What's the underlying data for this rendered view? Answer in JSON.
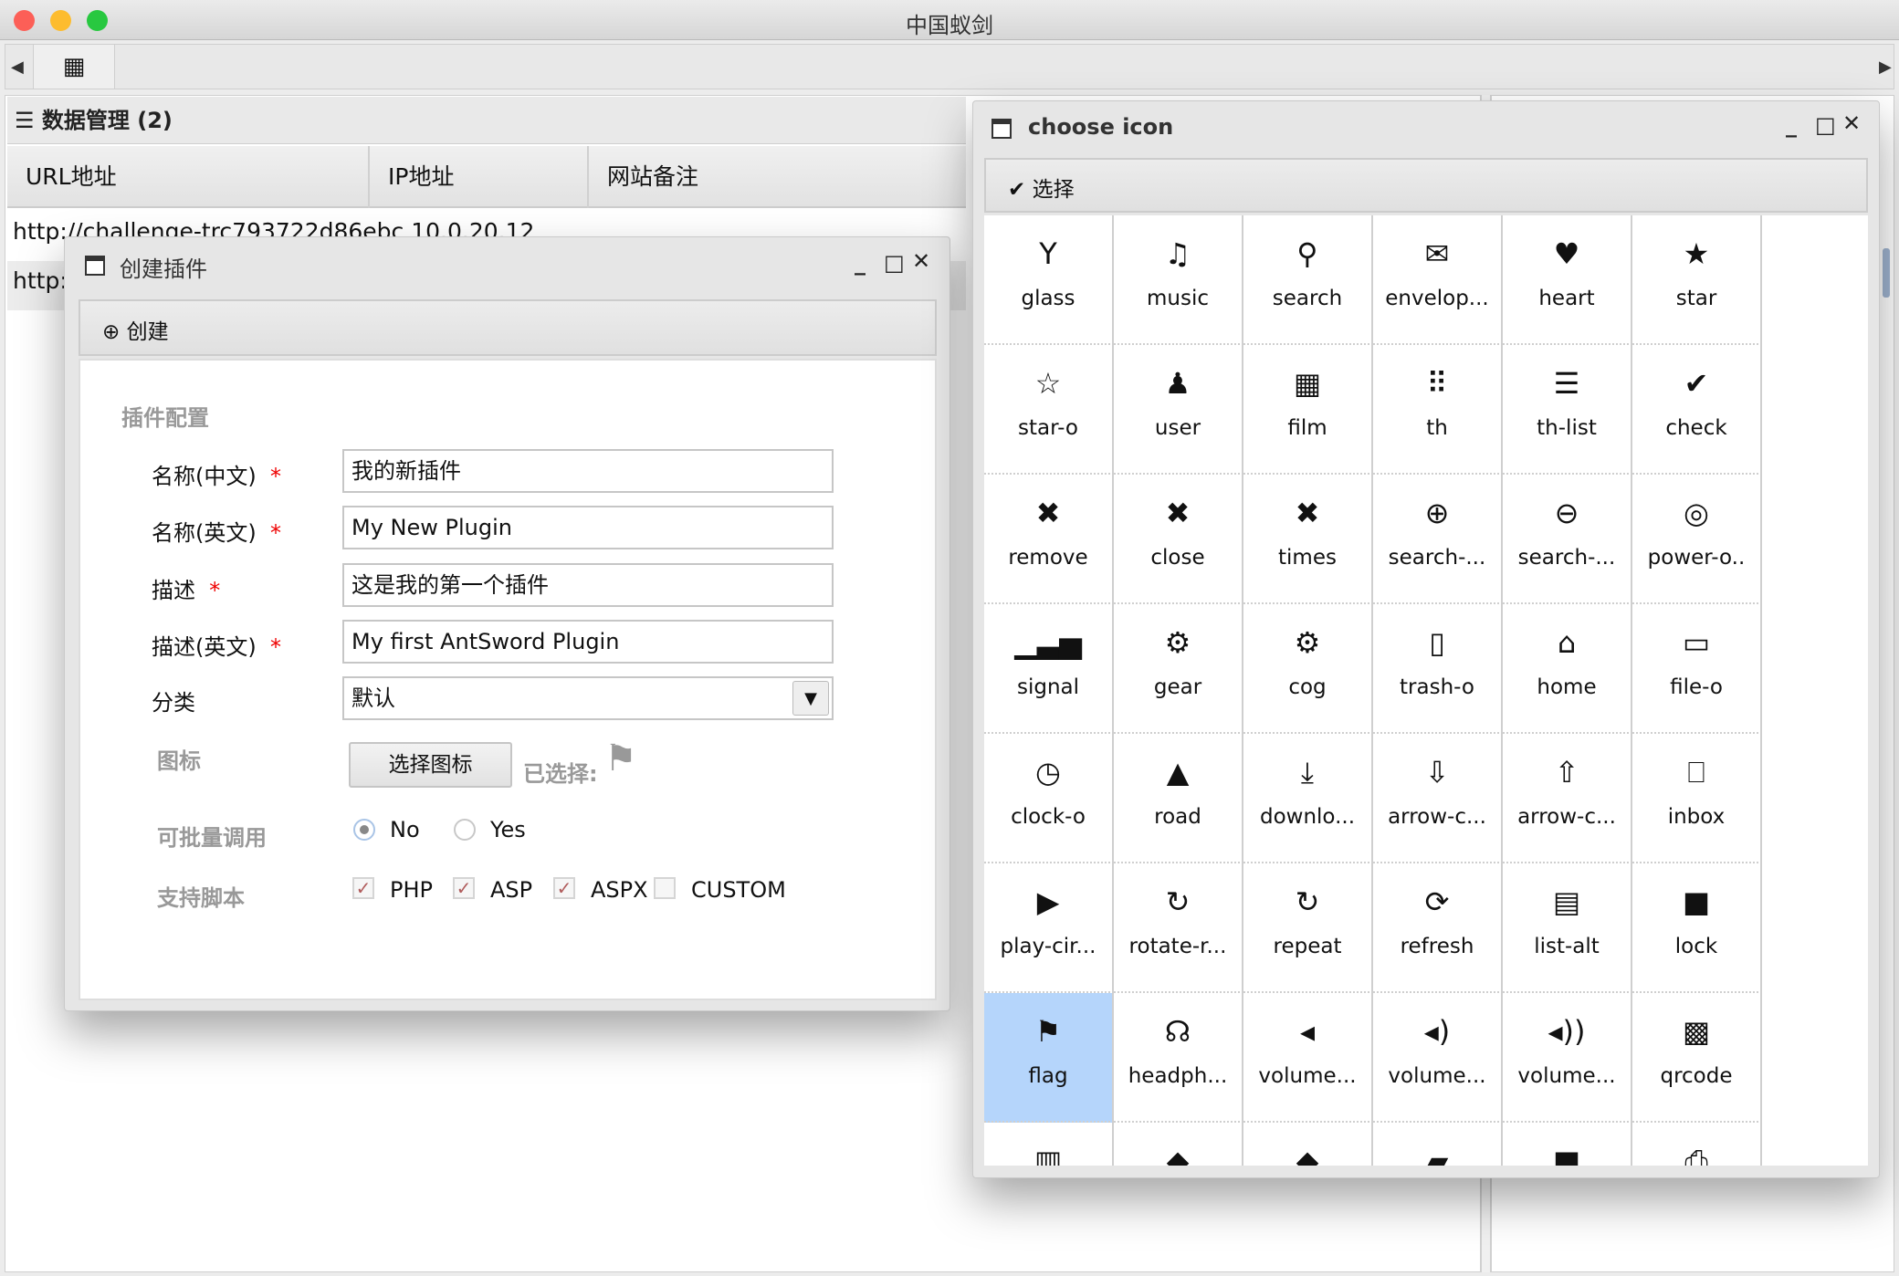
{
  "app": {
    "title": "中国蚁剑"
  },
  "tabs": {
    "home_icon": "th-large-icon"
  },
  "panel": {
    "title": "数据管理 (2)",
    "columns": [
      "URL地址",
      "IP地址",
      "网站备注"
    ],
    "rows": [
      {
        "url": "http://challenge-trc793722d86ebc",
        "ip": "10.0.20.12"
      },
      {
        "url": "http:",
        "ip": ""
      }
    ]
  },
  "plugin_window": {
    "title": "创建插件",
    "toolbar_create": "创建",
    "section": "插件配置",
    "fields": [
      {
        "label": "名称(中文)",
        "value": "我的新插件",
        "required": true
      },
      {
        "label": "名称(英文)",
        "value": "My New Plugin",
        "required": true
      },
      {
        "label": "描述",
        "value": "这是我的第一个插件",
        "required": true
      },
      {
        "label": "描述(英文)",
        "value": "My first AntSword Plugin",
        "required": true
      }
    ],
    "required_mark": "*",
    "category": {
      "label": "分类",
      "value": "默认"
    },
    "icon": {
      "label": "图标",
      "button": "选择图标",
      "selected_label": "已选择:",
      "selected_icon": "flag"
    },
    "batch": {
      "label": "可批量调用",
      "options": [
        "No",
        "Yes"
      ],
      "selected": "No"
    },
    "scripts": {
      "label": "支持脚本",
      "options": [
        {
          "name": "PHP",
          "checked": true
        },
        {
          "name": "ASP",
          "checked": true
        },
        {
          "name": "ASPX",
          "checked": true
        },
        {
          "name": "CUSTOM",
          "checked": false
        }
      ]
    }
  },
  "icon_window": {
    "title": "choose icon",
    "toolbar_select": "选择",
    "selected": "flag",
    "selected_color": "#b5d5fb",
    "icons": [
      {
        "name": "glass",
        "label": "glass",
        "glyph": "Y"
      },
      {
        "name": "music",
        "label": "music",
        "glyph": "♫"
      },
      {
        "name": "search",
        "label": "search",
        "glyph": "⚲"
      },
      {
        "name": "envelope-o",
        "label": "envelop...",
        "glyph": "✉"
      },
      {
        "name": "heart",
        "label": "heart",
        "glyph": "♥"
      },
      {
        "name": "star",
        "label": "star",
        "glyph": "★"
      },
      {
        "name": "star-o",
        "label": "star-o",
        "glyph": "☆"
      },
      {
        "name": "user",
        "label": "user",
        "glyph": "♟"
      },
      {
        "name": "film",
        "label": "film",
        "glyph": "▦"
      },
      {
        "name": "th",
        "label": "th",
        "glyph": "⠿"
      },
      {
        "name": "th-list",
        "label": "th-list",
        "glyph": "☰"
      },
      {
        "name": "check",
        "label": "check",
        "glyph": "✔"
      },
      {
        "name": "remove",
        "label": "remove",
        "glyph": "✖"
      },
      {
        "name": "close",
        "label": "close",
        "glyph": "✖"
      },
      {
        "name": "times",
        "label": "times",
        "glyph": "✖"
      },
      {
        "name": "search-plus",
        "label": "search-...",
        "glyph": "⊕"
      },
      {
        "name": "search-minus",
        "label": "search-...",
        "glyph": "⊖"
      },
      {
        "name": "power-off",
        "label": "power-o..",
        "glyph": "◎"
      },
      {
        "name": "signal",
        "label": "signal",
        "glyph": "▁▃▅"
      },
      {
        "name": "gear",
        "label": "gear",
        "glyph": "⚙"
      },
      {
        "name": "cog",
        "label": "cog",
        "glyph": "⚙"
      },
      {
        "name": "trash-o",
        "label": "trash-o",
        "glyph": "▯"
      },
      {
        "name": "home",
        "label": "home",
        "glyph": "⌂"
      },
      {
        "name": "file-o",
        "label": "file-o",
        "glyph": "▭"
      },
      {
        "name": "clock-o",
        "label": "clock-o",
        "glyph": "◷"
      },
      {
        "name": "road",
        "label": "road",
        "glyph": "▲"
      },
      {
        "name": "download",
        "label": "downlo...",
        "glyph": "⤓"
      },
      {
        "name": "arrow-circle-o-down",
        "label": "arrow-c...",
        "glyph": "⇩"
      },
      {
        "name": "arrow-circle-o-up",
        "label": "arrow-c...",
        "glyph": "⇧"
      },
      {
        "name": "inbox",
        "label": "inbox",
        "glyph": "⎕"
      },
      {
        "name": "play-circle-o",
        "label": "play-cir...",
        "glyph": "▶"
      },
      {
        "name": "rotate-right",
        "label": "rotate-r...",
        "glyph": "↻"
      },
      {
        "name": "repeat",
        "label": "repeat",
        "glyph": "↻"
      },
      {
        "name": "refresh",
        "label": "refresh",
        "glyph": "⟳"
      },
      {
        "name": "list-alt",
        "label": "list-alt",
        "glyph": "▤"
      },
      {
        "name": "lock",
        "label": "lock",
        "glyph": "■"
      },
      {
        "name": "flag",
        "label": "flag",
        "glyph": "⚑"
      },
      {
        "name": "headphones",
        "label": "headph...",
        "glyph": "☊"
      },
      {
        "name": "volume-off",
        "label": "volume...",
        "glyph": "◂"
      },
      {
        "name": "volume-down",
        "label": "volume...",
        "glyph": "◂)"
      },
      {
        "name": "volume-up",
        "label": "volume...",
        "glyph": "◂))"
      },
      {
        "name": "qrcode",
        "label": "qrcode",
        "glyph": "▩"
      },
      {
        "name": "barcode",
        "label": "",
        "glyph": "▥"
      },
      {
        "name": "tag",
        "label": "",
        "glyph": "◆"
      },
      {
        "name": "tags",
        "label": "",
        "glyph": "◆"
      },
      {
        "name": "book",
        "label": "",
        "glyph": "▰"
      },
      {
        "name": "bookmark",
        "label": "",
        "glyph": "■"
      },
      {
        "name": "print",
        "label": "",
        "glyph": "⎙"
      }
    ]
  }
}
